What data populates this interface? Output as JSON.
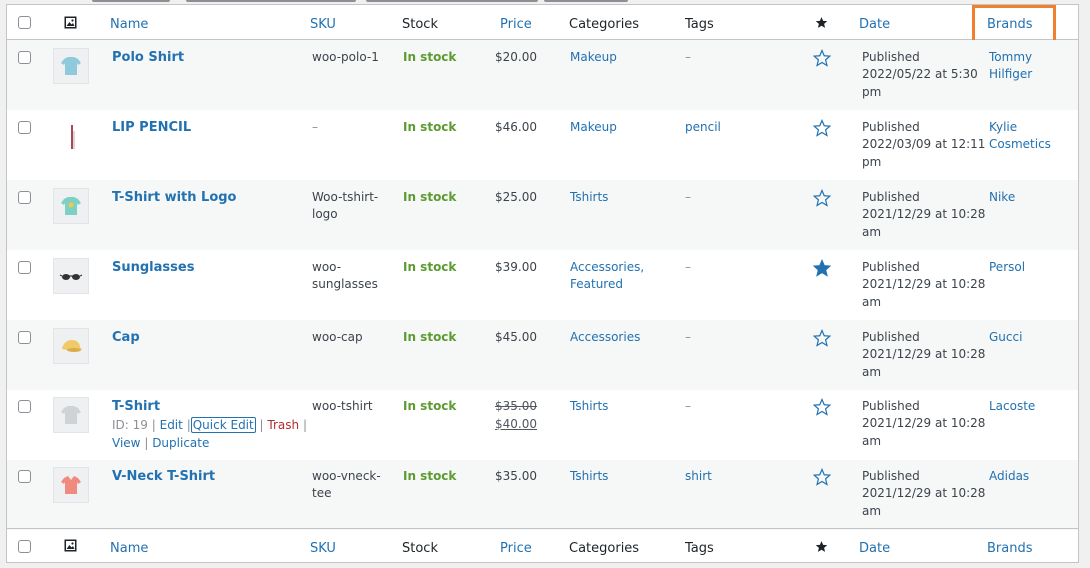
{
  "columns": {
    "name": "Name",
    "sku": "SKU",
    "stock": "Stock",
    "price": "Price",
    "categories": "Categories",
    "tags": "Tags",
    "date": "Date",
    "brands": "Brands"
  },
  "icons": {
    "image_col": "image-icon",
    "featured_col": "star-icon"
  },
  "colors": {
    "link": "#2271b1",
    "in_stock": "#5b9b2f",
    "highlight": "#f0802f",
    "trash": "#b32d2e"
  },
  "rows": [
    {
      "name": "Polo Shirt",
      "sku": "woo-polo-1",
      "stock": "In stock",
      "price": "$20.00",
      "categories": "Makeup",
      "tags": "–",
      "featured": false,
      "date_status": "Published",
      "date_line1": "2022/05/22 at 5:30",
      "date_line2": "pm",
      "brand": "Tommy Hilfiger"
    },
    {
      "name": "LIP PENCIL",
      "sku": "–",
      "stock": "In stock",
      "price": "$46.00",
      "categories": "Makeup",
      "tags": "pencil",
      "featured": false,
      "date_status": "Published",
      "date_line1": "2022/03/09 at 12:11",
      "date_line2": "pm",
      "brand": "Kylie Cosmetics"
    },
    {
      "name": "T-Shirt with Logo",
      "sku_line1": "Woo-tshirt-",
      "sku_line2": "logo",
      "stock": "In stock",
      "price": "$25.00",
      "categories": "Tshirts",
      "tags": "–",
      "featured": false,
      "date_status": "Published",
      "date_line1": "2021/12/29 at 10:28",
      "date_line2": "am",
      "brand": "Nike"
    },
    {
      "name": "Sunglasses",
      "sku_line1": "woo-",
      "sku_line2": "sunglasses",
      "stock": "In stock",
      "price": "$39.00",
      "categories_line1": "Accessories,",
      "categories_line2": "Featured",
      "tags": "–",
      "featured": true,
      "date_status": "Published",
      "date_line1": "2021/12/29 at 10:28",
      "date_line2": "am",
      "brand": "Persol"
    },
    {
      "name": "Cap",
      "sku": "woo-cap",
      "stock": "In stock",
      "price": "$45.00",
      "categories": "Accessories",
      "tags": "–",
      "featured": false,
      "date_status": "Published",
      "date_line1": "2021/12/29 at 10:28",
      "date_line2": "am",
      "brand": "Gucci"
    },
    {
      "name": "T-Shirt",
      "sku": "woo-tshirt",
      "stock": "In stock",
      "price_old": "$35.00",
      "price_new": "$40.00",
      "categories": "Tshirts",
      "tags": "–",
      "featured": false,
      "date_status": "Published",
      "date_line1": "2021/12/29 at 10:28",
      "date_line2": "am",
      "brand": "Lacoste",
      "row_actions": {
        "id": "ID: 19",
        "sep": "|",
        "edit": "Edit",
        "quick_edit": "Quick Edit",
        "trash": "Trash",
        "view": "View",
        "duplicate": "Duplicate"
      }
    },
    {
      "name": "V-Neck T-Shirt",
      "sku_line1": "woo-vneck-",
      "sku_line2": "tee",
      "stock": "In stock",
      "price": "$35.00",
      "categories": "Tshirts",
      "tags": "shirt",
      "featured": false,
      "date_status": "Published",
      "date_line1": "2021/12/29 at 10:28",
      "date_line2": "am",
      "brand": "Adidas"
    }
  ]
}
